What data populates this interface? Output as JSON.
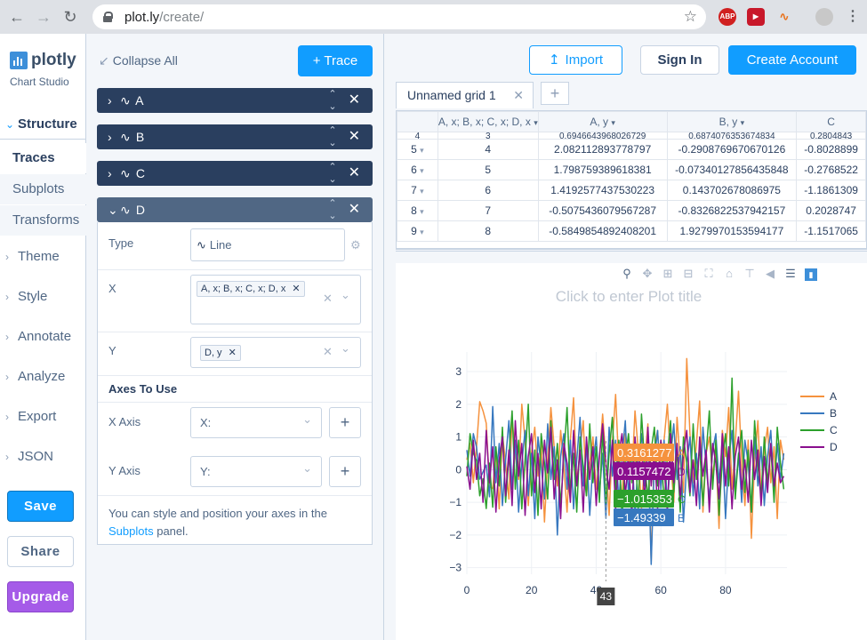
{
  "browser": {
    "url_host": "plot.ly",
    "url_path": "/create/"
  },
  "brand": {
    "name": "plotly",
    "subtitle": "Chart Studio"
  },
  "sidebar": {
    "active_section": "Structure",
    "sub_items": [
      "Traces",
      "Subplots",
      "Transforms"
    ],
    "sections": [
      "Theme",
      "Style",
      "Annotate",
      "Analyze",
      "Export",
      "JSON"
    ],
    "save": "Save",
    "share": "Share",
    "upgrade": "Upgrade"
  },
  "panel": {
    "collapse_all": "Collapse All",
    "add_trace": "+ Trace",
    "traces": [
      "A",
      "B",
      "C",
      "D"
    ],
    "open_trace": "D",
    "type_label": "Type",
    "type_value": "Line",
    "x_label": "X",
    "x_tag": "A, x; B, x; C, x; D, x",
    "y_label": "Y",
    "y_tag": "D, y",
    "axes_heading": "Axes To Use",
    "x_axis_label": "X Axis",
    "x_axis_value": "X:",
    "y_axis_label": "Y Axis",
    "y_axis_value": "Y:",
    "help_prefix": "You can style and position your axes in the",
    "help_link": "Subplots",
    "help_suffix": "panel."
  },
  "header": {
    "import": "Import",
    "sign_in": "Sign In",
    "create_account": "Create Account"
  },
  "grid": {
    "tab_name": "Unnamed grid 1",
    "columns": [
      "A, x; B, x; C, x; D, x",
      "A, y",
      "B, y",
      "C"
    ],
    "partial_row": {
      "n": "4",
      "values": [
        "3",
        "0.6946643968026729",
        "0.6874076353674834",
        "0.2804843"
      ]
    },
    "rows": [
      {
        "n": "5",
        "values": [
          "4",
          "2.082112893778797",
          "-0.2908769670670126",
          "-0.8028899"
        ]
      },
      {
        "n": "6",
        "values": [
          "5",
          "1.798759389618381",
          "-0.07340127856435848",
          "-0.2768522"
        ]
      },
      {
        "n": "7",
        "values": [
          "6",
          "1.4192577437530223",
          "0.143702678086975",
          "-1.1861309"
        ]
      },
      {
        "n": "8",
        "values": [
          "7",
          "-0.5075436079567287",
          "-0.8326822537942157",
          "0.2028747"
        ]
      },
      {
        "n": "9",
        "values": [
          "8",
          "-0.5849854892408201",
          "1.9279970153594177",
          "-1.1517065"
        ]
      }
    ]
  },
  "plot": {
    "title_placeholder": "Click to enter Plot title",
    "hover_x": "43",
    "hover_labels": [
      {
        "value": "0.3161277",
        "series": "A",
        "color": "#f5923e"
      },
      {
        "value": "0.1157472",
        "series": "D",
        "color": "#8a0f8e"
      },
      {
        "value": "−1.015353",
        "series": "C",
        "color": "#2ca02c"
      },
      {
        "value": "−1.49339",
        "series": "B",
        "color": "#3778bf"
      }
    ]
  },
  "chart_data": {
    "type": "line",
    "title": "",
    "xlabel": "",
    "ylabel": "",
    "xlim": [
      0,
      99
    ],
    "ylim": [
      -3.2,
      3.6
    ],
    "x_ticks": [
      0,
      20,
      40,
      60,
      80
    ],
    "y_ticks": [
      -3,
      -2,
      -1,
      0,
      1,
      2,
      3
    ],
    "legend_position": "right",
    "series": [
      {
        "name": "A",
        "color": "#f5923e",
        "values": [
          0.3,
          0.8,
          -0.4,
          0.69,
          2.08,
          1.8,
          1.42,
          -0.51,
          -0.58,
          0.6,
          -1.2,
          1.1,
          0.2,
          -0.9,
          1.6,
          0.4,
          -0.3,
          2.0,
          0.9,
          -1.1,
          0.5,
          1.3,
          -0.2,
          0.8,
          -1.6,
          0.3,
          1.9,
          0.7,
          -0.5,
          1.2,
          0.1,
          -1.3,
          0.9,
          2.2,
          -0.4,
          0.6,
          1.5,
          -0.8,
          0.2,
          1.0,
          -0.6,
          0.4,
          1.7,
          0.32,
          -1.4,
          0.8,
          2.3,
          0.1,
          -0.9,
          1.1,
          0.5,
          -0.3,
          1.8,
          0.6,
          -1.2,
          0.3,
          1.4,
          -2.8,
          0.7,
          1.2,
          -0.5,
          0.9,
          2.0,
          0.3,
          -1.0,
          1.6,
          0.2,
          -0.7,
          3.4,
          1.1,
          -0.4,
          0.8,
          2.1,
          -1.3,
          0.5,
          1.0,
          -0.2,
          0.6,
          -1.8,
          1.2,
          0.4,
          1.9,
          -0.6,
          0.8,
          2.4,
          0.2,
          -1.1,
          0.9,
          -2.1,
          0.3,
          1.5,
          -0.8,
          0.6,
          1.3,
          -0.4,
          0.7,
          -1.5,
          0.9,
          0.3
        ]
      },
      {
        "name": "B",
        "color": "#3778bf",
        "values": [
          0.6,
          -0.2,
          1.1,
          0.69,
          -0.29,
          -0.07,
          0.14,
          -0.83,
          1.93,
          -0.4,
          0.8,
          -1.1,
          0.3,
          1.5,
          -0.6,
          0.9,
          -1.3,
          0.2,
          1.2,
          -0.8,
          0.5,
          -1.5,
          1.0,
          0.1,
          -0.9,
          1.4,
          -0.3,
          0.7,
          -2.0,
          0.4,
          1.1,
          -0.6,
          0.9,
          -1.2,
          0.3,
          1.6,
          -0.5,
          0.8,
          -1.4,
          0.2,
          1.0,
          -0.7,
          0.5,
          -1.49,
          1.3,
          -0.2,
          0.9,
          -1.0,
          0.4,
          1.5,
          -0.8,
          0.6,
          -1.3,
          0.2,
          1.1,
          -0.5,
          0.8,
          -2.9,
          0.3,
          1.2,
          -0.6,
          0.9,
          -1.1,
          0.4,
          1.4,
          -0.3,
          0.7,
          -1.6,
          0.2,
          1.0,
          -0.8,
          0.5,
          -1.2,
          1.3,
          0.1,
          -0.9,
          0.6,
          1.1,
          -0.4,
          0.8,
          -1.5,
          0.3,
          1.2,
          -0.7,
          0.5,
          -1.0,
          0.9,
          0.2,
          -1.3,
          1.0,
          -0.5,
          0.7,
          -1.1,
          0.4,
          1.2,
          -0.6,
          0.8,
          -0.3,
          0.5
        ]
      },
      {
        "name": "C",
        "color": "#2ca02c",
        "values": [
          -0.2,
          1.1,
          0.5,
          0.28,
          -0.8,
          -0.28,
          -1.19,
          0.2,
          -1.15,
          0.7,
          -0.5,
          1.3,
          -1.0,
          0.4,
          1.8,
          -0.6,
          0.9,
          -1.2,
          0.3,
          2.0,
          -0.8,
          0.6,
          -1.4,
          1.1,
          0.2,
          -0.9,
          1.5,
          -0.3,
          0.8,
          -1.1,
          0.4,
          1.9,
          -0.7,
          0.5,
          -1.3,
          1.0,
          0.1,
          -0.8,
          1.4,
          -0.4,
          0.7,
          -1.0,
          1.2,
          -1.02,
          0.5,
          1.6,
          -0.6,
          0.9,
          -1.5,
          0.3,
          1.1,
          -0.4,
          0.8,
          -1.2,
          1.7,
          0.2,
          -0.9,
          0.6,
          1.3,
          -0.5,
          0.9,
          -1.1,
          0.4,
          1.5,
          -0.7,
          0.6,
          -1.3,
          1.0,
          0.2,
          -0.8,
          1.4,
          -0.3,
          0.7,
          -1.1,
          0.5,
          1.8,
          -0.6,
          0.9,
          -1.4,
          0.3,
          1.1,
          -0.5,
          2.8,
          -0.9,
          0.4,
          1.2,
          -0.7,
          0.6,
          -1.3,
          1.5,
          0.1,
          -0.8,
          1.0,
          -0.4,
          0.7,
          -1.0,
          1.3,
          0.2,
          -0.6
        ]
      },
      {
        "name": "D",
        "color": "#8a0f8e",
        "values": [
          0.1,
          -0.6,
          0.9,
          -0.3,
          0.5,
          -1.0,
          1.2,
          -0.4,
          0.7,
          -1.3,
          0.3,
          1.0,
          -0.8,
          0.6,
          -1.1,
          1.5,
          -0.2,
          0.8,
          -1.4,
          0.4,
          1.1,
          -0.7,
          0.5,
          -1.2,
          0.9,
          -0.1,
          1.3,
          -0.9,
          0.3,
          -1.5,
          0.8,
          0.2,
          -1.0,
          1.2,
          -0.5,
          0.6,
          -1.3,
          1.0,
          -0.3,
          0.7,
          -1.1,
          0.4,
          1.4,
          0.12,
          -0.6,
          0.9,
          -1.2,
          0.5,
          1.1,
          -0.8,
          0.3,
          -1.4,
          1.0,
          -0.2,
          0.7,
          -1.0,
          1.3,
          -0.5,
          0.6,
          -1.2,
          0.9,
          0.1,
          -1.3,
          1.1,
          -0.4,
          0.8,
          -0.9,
          0.5,
          1.2,
          -0.7,
          0.3,
          -1.1,
          1.0,
          -0.2,
          0.6,
          -1.3,
          0.8,
          0.2,
          -0.9,
          1.1,
          -0.5,
          0.7,
          -1.2,
          0.4,
          1.0,
          -0.6,
          0.3,
          -1.0,
          0.9,
          -0.3,
          0.6,
          -1.1,
          0.4,
          -0.7,
          0.8,
          -0.5,
          0.2,
          -0.4,
          -0.2
        ]
      }
    ]
  }
}
